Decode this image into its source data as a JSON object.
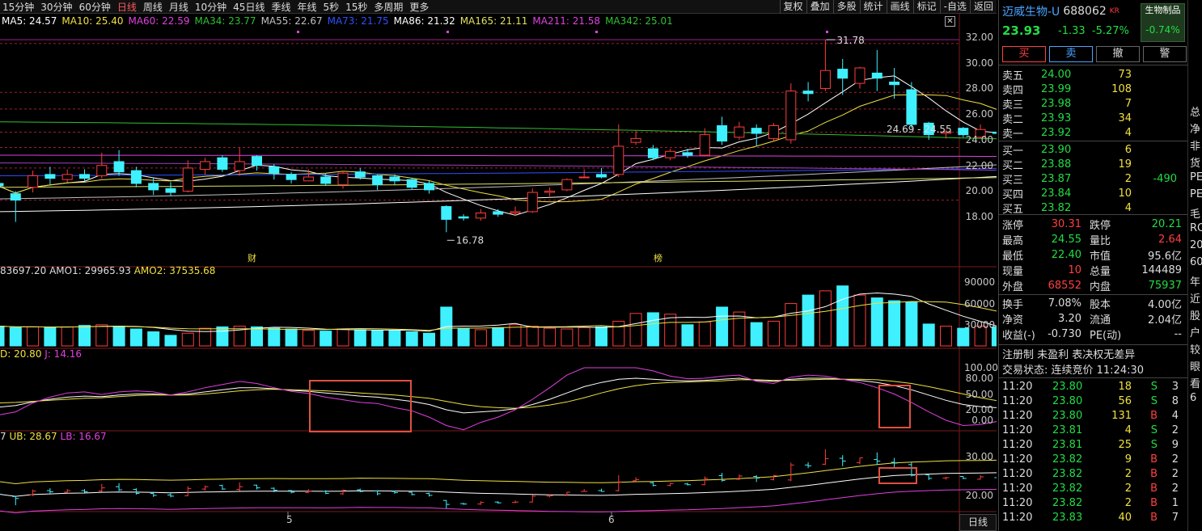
{
  "toolbar": {
    "periods": [
      "15分钟",
      "30分钟",
      "60分钟",
      "日线",
      "周线",
      "月线",
      "10分钟",
      "45日线",
      "季线",
      "年线",
      "5秒",
      "15秒",
      "多周期",
      "更多"
    ],
    "active_period": "日线",
    "tools": [
      "复权",
      "叠加",
      "多股",
      "统计",
      "画线",
      "标记",
      "-自选",
      "返回"
    ]
  },
  "ma_legend": [
    {
      "label": "MA5: 24.57",
      "color": "#ffffff"
    },
    {
      "label": "MA10: 25.40",
      "color": "#f0e040"
    },
    {
      "label": "MA60: 22.59",
      "color": "#e040e0"
    },
    {
      "label": "MA34: 23.77",
      "color": "#30c030"
    },
    {
      "label": "MA55: 22.67",
      "color": "#c0c0c0"
    },
    {
      "label": "MA73: 21.75",
      "color": "#3050ff"
    },
    {
      "label": "MA86: 21.32",
      "color": "#ffffff"
    },
    {
      "label": "MA165: 21.11",
      "color": "#e0e060"
    },
    {
      "label": "MA211: 21.58",
      "color": "#e040e0"
    },
    {
      "label": "MA342: 25.01",
      "color": "#30c030"
    }
  ],
  "price_axis": [
    "32.00",
    "30.00",
    "28.00",
    "26.00",
    "24.00",
    "22.00",
    "20.00",
    "18.00"
  ],
  "annotations": {
    "high": "31.78",
    "low": "16.78",
    "range": "24.69 - 24.55",
    "cai": "财",
    "bang": "榜"
  },
  "volume_legend": {
    "a": "83697.20",
    "amo1": "AMO1: 29965.93",
    "amo2": "AMO2: 37535.68"
  },
  "volume_axis": [
    "90000",
    "60000",
    "30000"
  ],
  "kdj_legend": {
    "d": "D: 20.80",
    "j": "J: 14.16"
  },
  "kdj_axis": [
    "100.00",
    "80.00",
    "50.00",
    "20.00",
    "0.00"
  ],
  "boll_legend": {
    "m": "7",
    "ub": "UB: 28.67",
    "lb": "LB: 16.67"
  },
  "boll_axis": [
    "30.00",
    "20.00"
  ],
  "x_axis": [
    "5",
    "6"
  ],
  "bottom_tab": "日线",
  "stock": {
    "name": "迈威生物-U",
    "code": "688062",
    "kr": "KR",
    "sector": "生物制品",
    "sector_chg": "-0.74%",
    "price": "23.93",
    "change": "-1.33",
    "pct": "-5.27%",
    "buttons": [
      "买",
      "卖",
      "撤",
      "警"
    ]
  },
  "orderbook": {
    "sells": [
      {
        "label": "卖五",
        "price": "24.00",
        "vol": "73",
        "extra": ""
      },
      {
        "label": "卖四",
        "price": "23.99",
        "vol": "108",
        "extra": ""
      },
      {
        "label": "卖三",
        "price": "23.98",
        "vol": "7",
        "extra": ""
      },
      {
        "label": "卖二",
        "price": "23.93",
        "vol": "34",
        "extra": ""
      },
      {
        "label": "卖一",
        "price": "23.92",
        "vol": "4",
        "extra": ""
      }
    ],
    "buys": [
      {
        "label": "买一",
        "price": "23.90",
        "vol": "6",
        "extra": ""
      },
      {
        "label": "买二",
        "price": "23.88",
        "vol": "19",
        "extra": ""
      },
      {
        "label": "买三",
        "price": "23.87",
        "vol": "2",
        "extra": "-490"
      },
      {
        "label": "买四",
        "price": "23.84",
        "vol": "10",
        "extra": ""
      },
      {
        "label": "买五",
        "price": "23.82",
        "vol": "4",
        "extra": ""
      }
    ]
  },
  "stats": [
    [
      {
        "k": "涨停",
        "v": "30.31",
        "c": "#ff4040"
      },
      {
        "k": "跌停",
        "v": "20.21",
        "c": "#22dd44"
      }
    ],
    [
      {
        "k": "最高",
        "v": "24.55",
        "c": "#22dd44"
      },
      {
        "k": "量比",
        "v": "2.64",
        "c": "#ff4040"
      }
    ],
    [
      {
        "k": "最低",
        "v": "22.40",
        "c": "#22dd44"
      },
      {
        "k": "市值",
        "v": "95.6亿",
        "c": "#dddddd"
      }
    ],
    [
      {
        "k": "现量",
        "v": "10",
        "c": "#ff4040"
      },
      {
        "k": "总量",
        "v": "144489",
        "c": "#dddddd"
      }
    ],
    [
      {
        "k": "外盘",
        "v": "68552",
        "c": "#ff4040"
      },
      {
        "k": "内盘",
        "v": "75937",
        "c": "#22dd44"
      }
    ],
    [
      {
        "k": "换手",
        "v": "7.08%",
        "c": "#dddddd"
      },
      {
        "k": "股本",
        "v": "4.00亿",
        "c": "#dddddd"
      }
    ],
    [
      {
        "k": "净资",
        "v": "3.20",
        "c": "#dddddd"
      },
      {
        "k": "流通",
        "v": "2.04亿",
        "c": "#dddddd"
      }
    ],
    [
      {
        "k": "收益(-)",
        "v": "-0.730",
        "c": "#dddddd"
      },
      {
        "k": "PE(动)",
        "v": "--",
        "c": "#dddddd"
      }
    ]
  ],
  "notice": "注册制 未盈利 表决权无差异",
  "trade_status": "交易状态: 连续竞价 11:24:30",
  "ticks": [
    {
      "t": "11:20",
      "p": "23.80",
      "v": "18",
      "bs": "S",
      "n": "3"
    },
    {
      "t": "11:20",
      "p": "23.80",
      "v": "56",
      "bs": "S",
      "n": "8"
    },
    {
      "t": "11:20",
      "p": "23.80",
      "v": "131",
      "bs": "B",
      "n": "4"
    },
    {
      "t": "11:20",
      "p": "23.81",
      "v": "4",
      "bs": "S",
      "n": "2"
    },
    {
      "t": "11:20",
      "p": "23.81",
      "v": "25",
      "bs": "S",
      "n": "9"
    },
    {
      "t": "11:20",
      "p": "23.82",
      "v": "9",
      "bs": "B",
      "n": "2"
    },
    {
      "t": "11:20",
      "p": "23.82",
      "v": "2",
      "bs": "B",
      "n": "2"
    },
    {
      "t": "11:20",
      "p": "23.82",
      "v": "2",
      "bs": "B",
      "n": "2"
    },
    {
      "t": "11:20",
      "p": "23.82",
      "v": "2",
      "bs": "B",
      "n": "1"
    },
    {
      "t": "11:20",
      "p": "23.83",
      "v": "40",
      "bs": "B",
      "n": "7"
    }
  ],
  "rightcut": [
    "总",
    "净",
    "非",
    "货",
    "PE",
    "PE",
    "毛",
    "RO",
    "20",
    "60",
    "年",
    "近",
    "股",
    "户",
    "较",
    "眼",
    "看",
    "6"
  ],
  "chart_data": {
    "type": "candlestick",
    "ylim": [
      16.0,
      32.5
    ],
    "candles": [
      [
        20.6,
        20.4,
        21.5,
        19.6
      ],
      [
        19.8,
        19.3,
        20.0,
        17.6
      ],
      [
        20.3,
        21.2,
        21.6,
        19.9
      ],
      [
        21.3,
        21.0,
        21.9,
        20.5
      ],
      [
        20.9,
        21.3,
        21.7,
        20.7
      ],
      [
        21.3,
        21.0,
        21.7,
        20.8
      ],
      [
        21.2,
        22.0,
        23.0,
        21.0
      ],
      [
        22.3,
        21.5,
        23.2,
        21.2
      ],
      [
        21.6,
        20.6,
        21.9,
        20.3
      ],
      [
        20.6,
        20.1,
        21.0,
        19.7
      ],
      [
        20.2,
        19.9,
        20.7,
        19.6
      ],
      [
        20.0,
        21.8,
        22.4,
        19.9
      ],
      [
        21.7,
        22.3,
        22.6,
        21.3
      ],
      [
        22.6,
        21.7,
        22.8,
        21.5
      ],
      [
        21.6,
        22.3,
        23.4,
        21.2
      ],
      [
        22.7,
        22.0,
        22.8,
        21.6
      ],
      [
        21.9,
        21.4,
        22.1,
        20.9
      ],
      [
        21.3,
        20.9,
        21.5,
        20.6
      ],
      [
        20.8,
        21.1,
        21.7,
        20.8
      ],
      [
        21.1,
        20.6,
        21.4,
        20.4
      ],
      [
        20.5,
        21.4,
        21.6,
        20.2
      ],
      [
        21.5,
        21.1,
        21.8,
        20.9
      ],
      [
        21.2,
        20.5,
        21.3,
        20.1
      ],
      [
        21.1,
        20.8,
        21.3,
        20.5
      ],
      [
        20.9,
        20.3,
        21.0,
        20.1
      ],
      [
        20.6,
        20.1,
        20.8,
        19.8
      ],
      [
        18.8,
        17.8,
        18.9,
        16.8
      ],
      [
        18.0,
        17.9,
        18.2,
        17.7
      ],
      [
        17.9,
        18.3,
        18.6,
        17.7
      ],
      [
        18.4,
        18.2,
        18.6,
        18.0
      ],
      [
        18.3,
        18.4,
        18.8,
        18.1
      ],
      [
        18.4,
        19.9,
        20.2,
        18.3
      ],
      [
        19.9,
        20.0,
        20.3,
        19.6
      ],
      [
        20.1,
        20.9,
        21.0,
        20.0
      ],
      [
        21.1,
        21.1,
        21.7,
        21.0
      ],
      [
        21.3,
        21.1,
        21.8,
        21.0
      ],
      [
        21.3,
        23.5,
        25.2,
        21.1
      ],
      [
        23.8,
        24.1,
        24.7,
        23.6
      ],
      [
        23.3,
        22.6,
        23.6,
        22.4
      ],
      [
        22.6,
        23.1,
        23.3,
        22.4
      ],
      [
        23.0,
        22.8,
        23.3,
        22.6
      ],
      [
        22.8,
        24.4,
        24.9,
        22.7
      ],
      [
        25.1,
        23.9,
        25.8,
        23.6
      ],
      [
        24.2,
        25.0,
        25.4,
        24.0
      ],
      [
        24.9,
        24.5,
        25.2,
        23.5
      ],
      [
        24.1,
        25.1,
        25.3,
        23.9
      ],
      [
        24.0,
        27.8,
        28.4,
        23.7
      ],
      [
        27.8,
        27.6,
        28.5,
        27.0
      ],
      [
        28.0,
        29.4,
        31.8,
        27.8
      ],
      [
        29.5,
        28.8,
        30.3,
        27.5
      ],
      [
        28.4,
        29.6,
        29.7,
        28.0
      ],
      [
        29.2,
        28.8,
        31.0,
        27.8
      ],
      [
        28.5,
        28.3,
        29.6,
        27.2
      ],
      [
        27.9,
        25.2,
        28.5,
        24.9
      ],
      [
        25.3,
        24.4,
        25.4,
        24.0
      ],
      [
        24.5,
        24.6,
        24.8,
        24.1
      ],
      [
        24.9,
        24.4,
        25.0,
        24.2
      ],
      [
        24.2,
        24.8,
        25.2,
        24.1
      ],
      [
        24.6,
        24.5,
        24.8,
        24.3
      ],
      [
        24.7,
        25.3,
        25.7,
        24.6
      ],
      [
        24.5,
        23.9,
        24.7,
        22.4
      ]
    ],
    "volumes": [
      28000,
      26000,
      27000,
      26000,
      27000,
      29000,
      30000,
      28000,
      24000,
      20000,
      15000,
      18000,
      25000,
      27000,
      28000,
      27000,
      25000,
      24000,
      22000,
      21000,
      24000,
      23000,
      22000,
      22000,
      20000,
      18000,
      55000,
      25000,
      23000,
      26000,
      30000,
      28000,
      25000,
      24000,
      26000,
      27000,
      35000,
      46000,
      47000,
      45000,
      30000,
      34000,
      55000,
      48000,
      33000,
      35000,
      60000,
      72000,
      78000,
      85000,
      72000,
      68000,
      64000,
      62000,
      31000,
      28000,
      25000,
      28000,
      27000,
      40000,
      34000
    ],
    "kdj_k": [
      25,
      28,
      35,
      40,
      44,
      46,
      45,
      48,
      50,
      50,
      48,
      50,
      54,
      58,
      62,
      62,
      60,
      57,
      55,
      52,
      49,
      46,
      44,
      40,
      36,
      30,
      20,
      14,
      16,
      18,
      22,
      30,
      40,
      52,
      64,
      72,
      78,
      80,
      78,
      76,
      75,
      76,
      78,
      80,
      76,
      74,
      78,
      80,
      80,
      78,
      76,
      72,
      66,
      58,
      48,
      38,
      30,
      26,
      24,
      22,
      22
    ],
    "kdj_d": [
      33,
      34,
      36,
      38,
      40,
      42,
      43,
      45,
      47,
      48,
      48,
      48,
      50,
      53,
      56,
      58,
      59,
      58,
      57,
      56,
      54,
      52,
      50,
      48,
      45,
      42,
      36,
      30,
      26,
      24,
      23,
      25,
      29,
      35,
      43,
      52,
      60,
      66,
      70,
      72,
      73,
      74,
      75,
      77,
      77,
      76,
      76,
      77,
      78,
      78,
      78,
      77,
      74,
      70,
      64,
      57,
      50,
      43,
      37,
      31,
      25
    ],
    "kdj_j": [
      10,
      16,
      33,
      44,
      52,
      54,
      49,
      54,
      56,
      54,
      48,
      54,
      62,
      68,
      74,
      70,
      62,
      55,
      51,
      44,
      39,
      34,
      32,
      24,
      18,
      6,
      -10,
      -18,
      -4,
      6,
      20,
      40,
      62,
      86,
      100,
      100,
      100,
      100,
      94,
      84,
      79,
      80,
      84,
      86,
      74,
      70,
      82,
      86,
      84,
      78,
      72,
      62,
      50,
      34,
      16,
      0,
      -10,
      -8,
      -2,
      4,
      14
    ]
  }
}
